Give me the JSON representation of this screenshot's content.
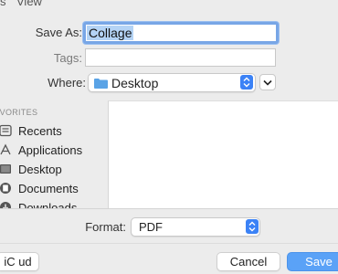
{
  "menubar": {
    "fragment_left": "s",
    "fragment_view": "View"
  },
  "form": {
    "save_as_label": "Save As:",
    "save_as_value": "Collage",
    "tags_label": "Tags:",
    "tags_value": "",
    "where_label": "Where:",
    "where_value": "Desktop"
  },
  "sidebar": {
    "heading": "AVORITES",
    "items": [
      {
        "label": "Recents",
        "icon": "recents-icon"
      },
      {
        "label": "Applications",
        "icon": "applications-icon"
      },
      {
        "label": "Desktop",
        "icon": "desktop-icon"
      },
      {
        "label": "Documents",
        "icon": "documents-icon"
      },
      {
        "label": "Downloads",
        "icon": "downloads-icon"
      }
    ]
  },
  "format": {
    "label": "Format:",
    "value": "PDF"
  },
  "buttons": {
    "icloud": "iC ud",
    "cancel": "Cancel",
    "save": "Save"
  },
  "colors": {
    "accent": "#5aa2f7",
    "focus_ring": "#78a6e6",
    "folder": "#5aa3e6"
  }
}
